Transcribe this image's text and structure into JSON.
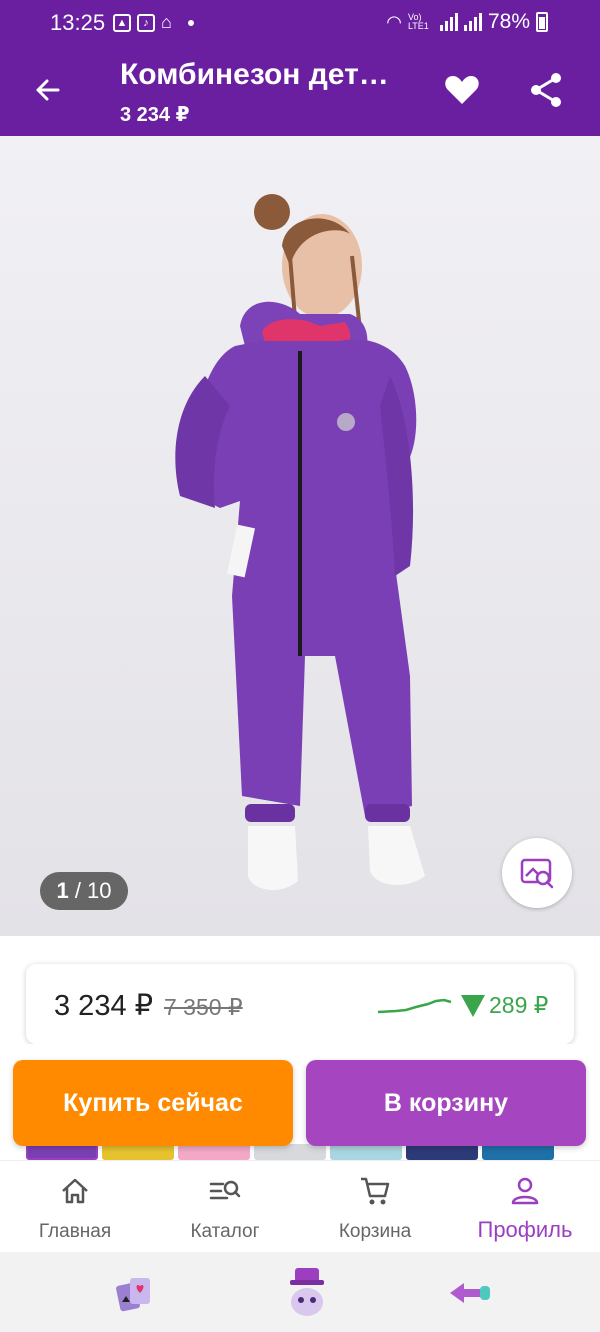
{
  "status_bar": {
    "time": "13:25",
    "battery": "78%",
    "network": "Vo) LTE1"
  },
  "app_bar": {
    "title": "Комбинезон дет…",
    "price": "3 234 ₽"
  },
  "gallery": {
    "current": "1",
    "separator": " / 10"
  },
  "price_card": {
    "price": "3 234 ₽",
    "old_price": "7 350 ₽",
    "drop": "289 ₽"
  },
  "actions": {
    "buy_now": "Купить сейчас",
    "add_to_cart": "В корзину"
  },
  "tabs": [
    {
      "label": "Главная",
      "icon": "home-icon"
    },
    {
      "label": "Каталог",
      "icon": "catalog-search-icon"
    },
    {
      "label": "Корзина",
      "icon": "cart-icon"
    },
    {
      "label": "Профиль",
      "icon": "profile-icon"
    }
  ],
  "colors": {
    "brand": "#6a1fa0",
    "accent_orange": "#ff8a00",
    "accent_purple": "#a645c0",
    "price_drop": "#3aa54a"
  }
}
